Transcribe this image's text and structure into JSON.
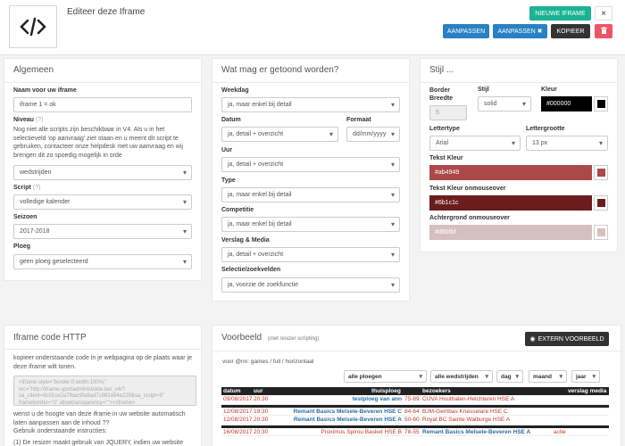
{
  "header": {
    "title": "Editeer deze Iframe",
    "buttons": {
      "new_iframe": "NIEUWE IFRAME",
      "close": "×",
      "save": "AANPASSEN",
      "save_close": "AANPASSEN ✖",
      "copy": "KOPIEER",
      "delete": "🗑"
    }
  },
  "algemeen": {
    "title": "Algemeen",
    "name_label": "Naam voor uw iframe",
    "name_value": "iframe 1 = ok",
    "niveau_label": "Niveau",
    "niveau_help": "Nog niet alle scripts zijn beschikbaar in V4. Als u in het selectieveld 'op aanvraag' ziet staan en u meent dit script te gebruiken, contacteer onze helpdesk met uw aanvraag en wij brengen dit zo spoedig mogelijk in orde",
    "niveau_value": "wedstrijden",
    "script_label": "Script",
    "script_value": "volledige kalender",
    "seizoen_label": "Seizoen",
    "seizoen_value": "2017-2018",
    "ploeg_label": "Ploeg",
    "ploeg_value": "geen ploeg geselecteerd",
    "q": "(?)"
  },
  "getoond": {
    "title": "Wat mag er getoond worden?",
    "weekdag_label": "Weekdag",
    "weekdag_value": "ja, maar enkel bij detail",
    "datum_label": "Datum",
    "datum_value": "ja, detail + overzicht",
    "formaat_label": "Formaat",
    "formaat_value": "dd/mm/yyyy",
    "uur_label": "Uur",
    "uur_value": "ja, detail + overzicht",
    "type_label": "Type",
    "type_value": "ja, maar enkel bij detail",
    "competitie_label": "Competitie",
    "competitie_value": "ja, maar enkel bij detail",
    "verslag_label": "Verslag & Media",
    "verslag_value": "ja, detail + overzicht",
    "selectie_label": "Selectie/zoekvelden",
    "selectie_value": "ja, voorzie de zoekfunctie"
  },
  "stijl": {
    "title": "Stijl ...",
    "border_label": "Border Breedte",
    "border_value": "5",
    "stijl_label": "Stijl",
    "stijl_value": "solid",
    "kleur_label": "Kleur",
    "kleur_value": "#000000",
    "lettertype_label": "Lettertype",
    "lettertype_value": "Arial",
    "lettergrootte_label": "Lettergrootte",
    "lettergrootte_value": "13 px",
    "tekst_kleur_label": "Tekst Kleur",
    "tekst_kleur_value": "#ab4949",
    "tekst_onm_label": "Tekst Kleur onmouseover",
    "tekst_onm_value": "#6b1c1c",
    "achtergrond_label": "Achtergrond onmouseover",
    "achtergrond_value": "#d6bfbf",
    "colors": {
      "kleur": "#000000",
      "tekst": "#ab4949",
      "tekst_onm": "#6b1c1c",
      "achtergrond": "#d6bfbf"
    }
  },
  "iframe_code": {
    "title": "Iframe code HTTP",
    "p1": "kopieer onderstaande code in je webpagina op de plaats waar je deze iframe wilt tonen.",
    "code": "<iframe style=\"border:0;width:100%;\" src=\"http://iframe.sportadministratie.be/_v4/?sa_client=9c01ce2a7fbac9fa6ad7c982a94e229&sa_script=9\" frameborder=\"0\" allowtransparency=\"\"></iframe>",
    "p2": "wenst u de hoogte van deze iframe in uw website automatisch laten aanpassen aan de inhoud ??",
    "p3": "Gebruik onderstaande instructies:",
    "p4": "(1) De resizer maakt gebruik van JQUERY, indien uw website deze"
  },
  "voorbeeld": {
    "title": "Voorbeeld",
    "subtitle": "(met resizer scripting)",
    "extern_button": "EXTERN VOORBEELD",
    "crumb": "voor @nn: games / full / horizontaal",
    "filters": [
      "alle ploegen",
      "alle wedstrijden",
      "dag",
      "maand",
      "jaar"
    ],
    "columns": {
      "datum": "datum",
      "uur": "uur",
      "thuisploeg": "thuisploeg",
      "bezoekers": "bezoekers",
      "verslag": "verslag media"
    },
    "rows": [
      {
        "date": "09/08/2017",
        "time": "20:30",
        "home": "testploeg van ann",
        "score": "75-89",
        "away": "CUVA Houthalen-Helchteren HSE A",
        "media": ""
      },
      {
        "date": "12/08/2017",
        "time": "19:30",
        "home": "Remant Basics Melsele-Beveren HSE C",
        "score": "84-64",
        "away": "BJM-Gembas Knesselare HSE C",
        "media": ""
      },
      {
        "date": "12/08/2017",
        "time": "20:30",
        "home": "Remant Basics Melsele-Beveren HSE A",
        "score": "50-60",
        "away": "Royal BC Sainte Walburge HSE A",
        "media": ""
      },
      {
        "date": "16/08/2017",
        "time": "20:30",
        "home": "Proximus Spirou Basket HSE B",
        "score": "78-55",
        "away": "Remant Basics Melsele-Beveren HSE A",
        "media": "actie"
      }
    ]
  }
}
